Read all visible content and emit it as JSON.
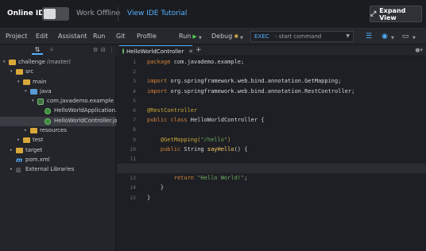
{
  "topbar": {
    "online_label": "Online IDE",
    "offline_label": "Work Offline",
    "tutorial_link": "View IDE Tutorial",
    "expand_label": "Expand View",
    "expand_icon": "⤢"
  },
  "menu": {
    "items": [
      "Project",
      "Edit",
      "Assistant",
      "Run",
      "Git",
      "Profile"
    ],
    "run_label": "Run",
    "debug_label": "Debug",
    "exec_label": "EXEC",
    "exec_placeholder": "- start command"
  },
  "sidebar": {
    "tree": [
      {
        "label": "challenge",
        "suffix": "(master)",
        "kind": "folder-y",
        "indent": 0,
        "arrow": "▾"
      },
      {
        "label": "src",
        "kind": "folder-y",
        "indent": 1,
        "arrow": "▾"
      },
      {
        "label": "main",
        "kind": "folder-y",
        "indent": 2,
        "arrow": "▾"
      },
      {
        "label": "java",
        "kind": "folder-b",
        "indent": 3,
        "arrow": "▾"
      },
      {
        "label": "com.javademo.example",
        "kind": "pkg",
        "indent": 4,
        "arrow": "▾"
      },
      {
        "label": "HelloWorldApplication.java",
        "kind": "java",
        "indent": 5,
        "arrow": ""
      },
      {
        "label": "HelloWorldController.java",
        "kind": "java",
        "indent": 5,
        "arrow": "",
        "selected": true
      },
      {
        "label": "resources",
        "kind": "folder-y",
        "indent": 3,
        "arrow": "▸"
      },
      {
        "label": "test",
        "kind": "folder-y",
        "indent": 2,
        "arrow": "▸"
      },
      {
        "label": "target",
        "kind": "folder-y",
        "indent": 1,
        "arrow": "▸"
      },
      {
        "label": "pom.xml",
        "kind": "maven",
        "indent": 1,
        "arrow": ""
      },
      {
        "label": "External Libraries",
        "kind": "lib",
        "indent": 1,
        "arrow": "▸"
      }
    ]
  },
  "editor": {
    "tab_label": "HelloWorldController",
    "line_numbers": [
      "1",
      "2",
      "3",
      "4",
      "5",
      "6",
      "7",
      "8",
      "9",
      "10",
      "11",
      "12",
      "13",
      "14",
      "15"
    ],
    "lines": [
      [
        {
          "t": "package ",
          "c": "kw"
        },
        {
          "t": "com.javademo.example;",
          "c": ""
        }
      ],
      [],
      [
        {
          "t": "import ",
          "c": "kw"
        },
        {
          "t": "org.springframework.web.bind.annotation.GetMapping;",
          "c": ""
        }
      ],
      [
        {
          "t": "import ",
          "c": "kw"
        },
        {
          "t": "org.springframework.web.bind.annotation.RestController;",
          "c": ""
        }
      ],
      [],
      [
        {
          "t": "@RestController",
          "c": "ann"
        }
      ],
      [
        {
          "t": "public class ",
          "c": "kw"
        },
        {
          "t": "HelloWorldController {",
          "c": ""
        }
      ],
      [],
      [
        {
          "t": "    @GetMapping(",
          "c": "ann"
        },
        {
          "t": "\"/hello\"",
          "c": "str"
        },
        {
          "t": ")",
          "c": "ann"
        }
      ],
      [
        {
          "t": "    public ",
          "c": "kw"
        },
        {
          "t": "String ",
          "c": ""
        },
        {
          "t": "sayHello",
          "c": "meth"
        },
        {
          "t": "() {",
          "c": ""
        }
      ],
      [],
      [],
      [
        {
          "t": "        return ",
          "c": "kw"
        },
        {
          "t": "\"Hello World!\"",
          "c": "str"
        },
        {
          "t": ";",
          "c": ""
        }
      ],
      [
        {
          "t": "    }",
          "c": ""
        }
      ],
      [
        {
          "t": "}",
          "c": ""
        }
      ]
    ]
  },
  "colors": {
    "accent": "#55b1ff",
    "background": "#1e1f24"
  }
}
